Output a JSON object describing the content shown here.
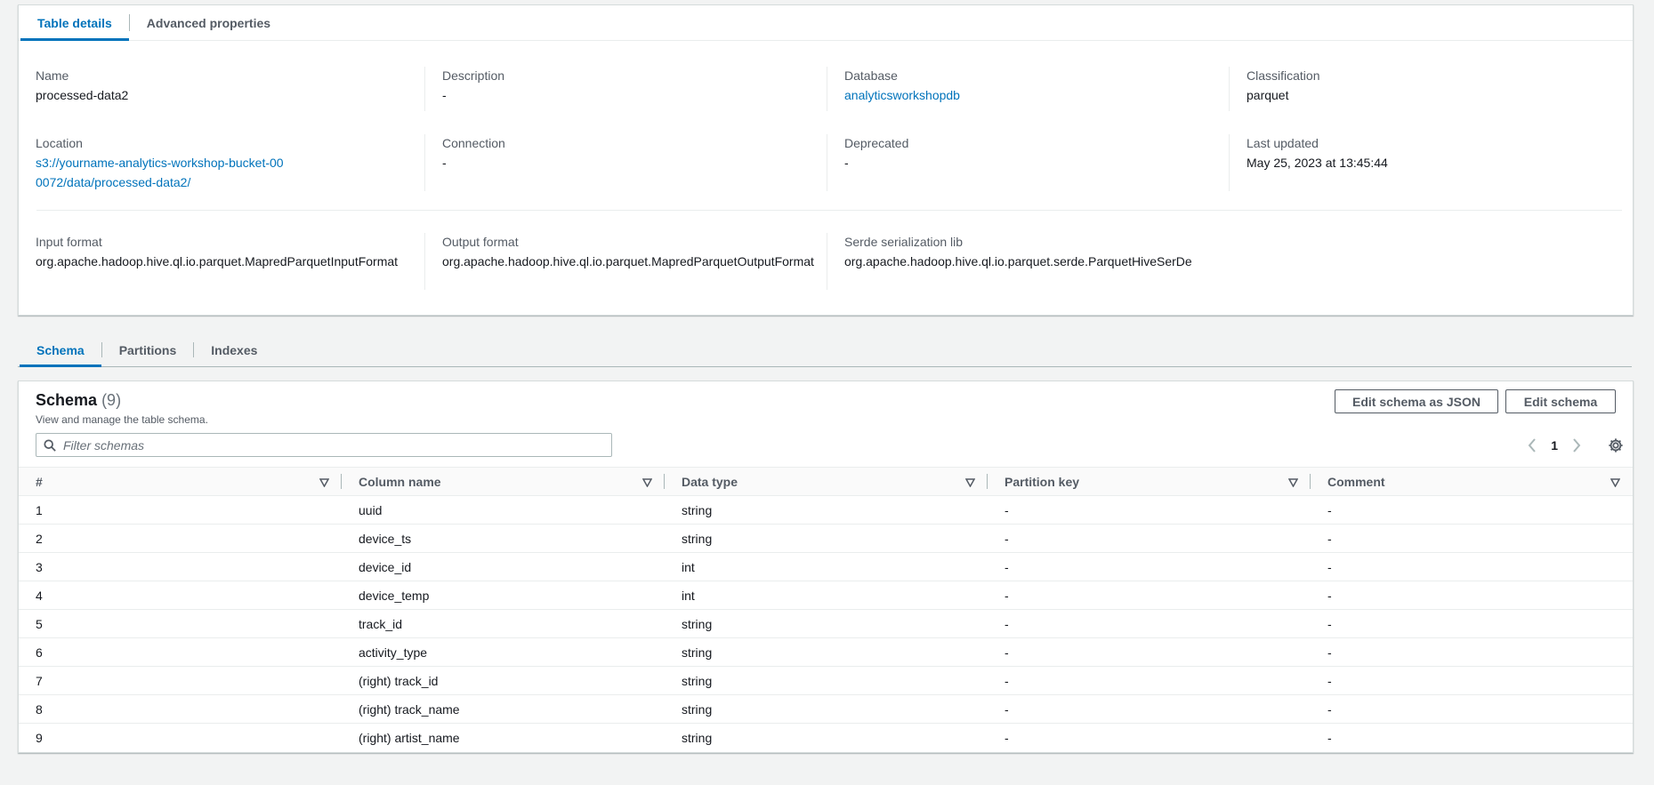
{
  "details_tabs": [
    "Table details",
    "Advanced properties"
  ],
  "details": {
    "row1": [
      {
        "label": "Name",
        "value": "processed-data2",
        "link": false
      },
      {
        "label": "Description",
        "value": "-",
        "link": false
      },
      {
        "label": "Database",
        "value": "analyticsworkshopdb",
        "link": true
      },
      {
        "label": "Classification",
        "value": "parquet",
        "link": false
      }
    ],
    "row2": [
      {
        "label": "Location",
        "value": "s3://yourname-analytics-workshop-bucket-000072/data/processed-data2/",
        "link": true
      },
      {
        "label": "Connection",
        "value": "-",
        "link": false
      },
      {
        "label": "Deprecated",
        "value": "-",
        "link": false
      },
      {
        "label": "Last updated",
        "value": "May 25, 2023 at 13:45:44",
        "link": false
      }
    ],
    "row3": [
      {
        "label": "Input format",
        "value": "org.apache.hadoop.hive.ql.io.parquet.MapredParquetInputFormat",
        "link": false
      },
      {
        "label": "Output format",
        "value": "org.apache.hadoop.hive.ql.io.parquet.MapredParquetOutputFormat",
        "link": false
      },
      {
        "label": "Serde serialization lib",
        "value": "org.apache.hadoop.hive.ql.io.parquet.serde.ParquetHiveSerDe",
        "link": false
      }
    ]
  },
  "section_tabs": [
    "Schema",
    "Partitions",
    "Indexes"
  ],
  "schema": {
    "title": "Schema",
    "count": "(9)",
    "subtitle": "View and manage the table schema.",
    "edit_json_label": "Edit schema as JSON",
    "edit_label": "Edit schema",
    "filter_placeholder": "Filter schemas",
    "page": "1",
    "columns": [
      "#",
      "Column name",
      "Data type",
      "Partition key",
      "Comment"
    ],
    "rows": [
      [
        "1",
        "uuid",
        "string",
        "-",
        "-"
      ],
      [
        "2",
        "device_ts",
        "string",
        "-",
        "-"
      ],
      [
        "3",
        "device_id",
        "int",
        "-",
        "-"
      ],
      [
        "4",
        "device_temp",
        "int",
        "-",
        "-"
      ],
      [
        "5",
        "track_id",
        "string",
        "-",
        "-"
      ],
      [
        "6",
        "activity_type",
        "string",
        "-",
        "-"
      ],
      [
        "7",
        "(right) track_id",
        "string",
        "-",
        "-"
      ],
      [
        "8",
        "(right) track_name",
        "string",
        "-",
        "-"
      ],
      [
        "9",
        "(right) artist_name",
        "string",
        "-",
        "-"
      ]
    ]
  },
  "colors": {
    "accent": "#0073bb",
    "text": "#16191f",
    "muted": "#545b64"
  }
}
